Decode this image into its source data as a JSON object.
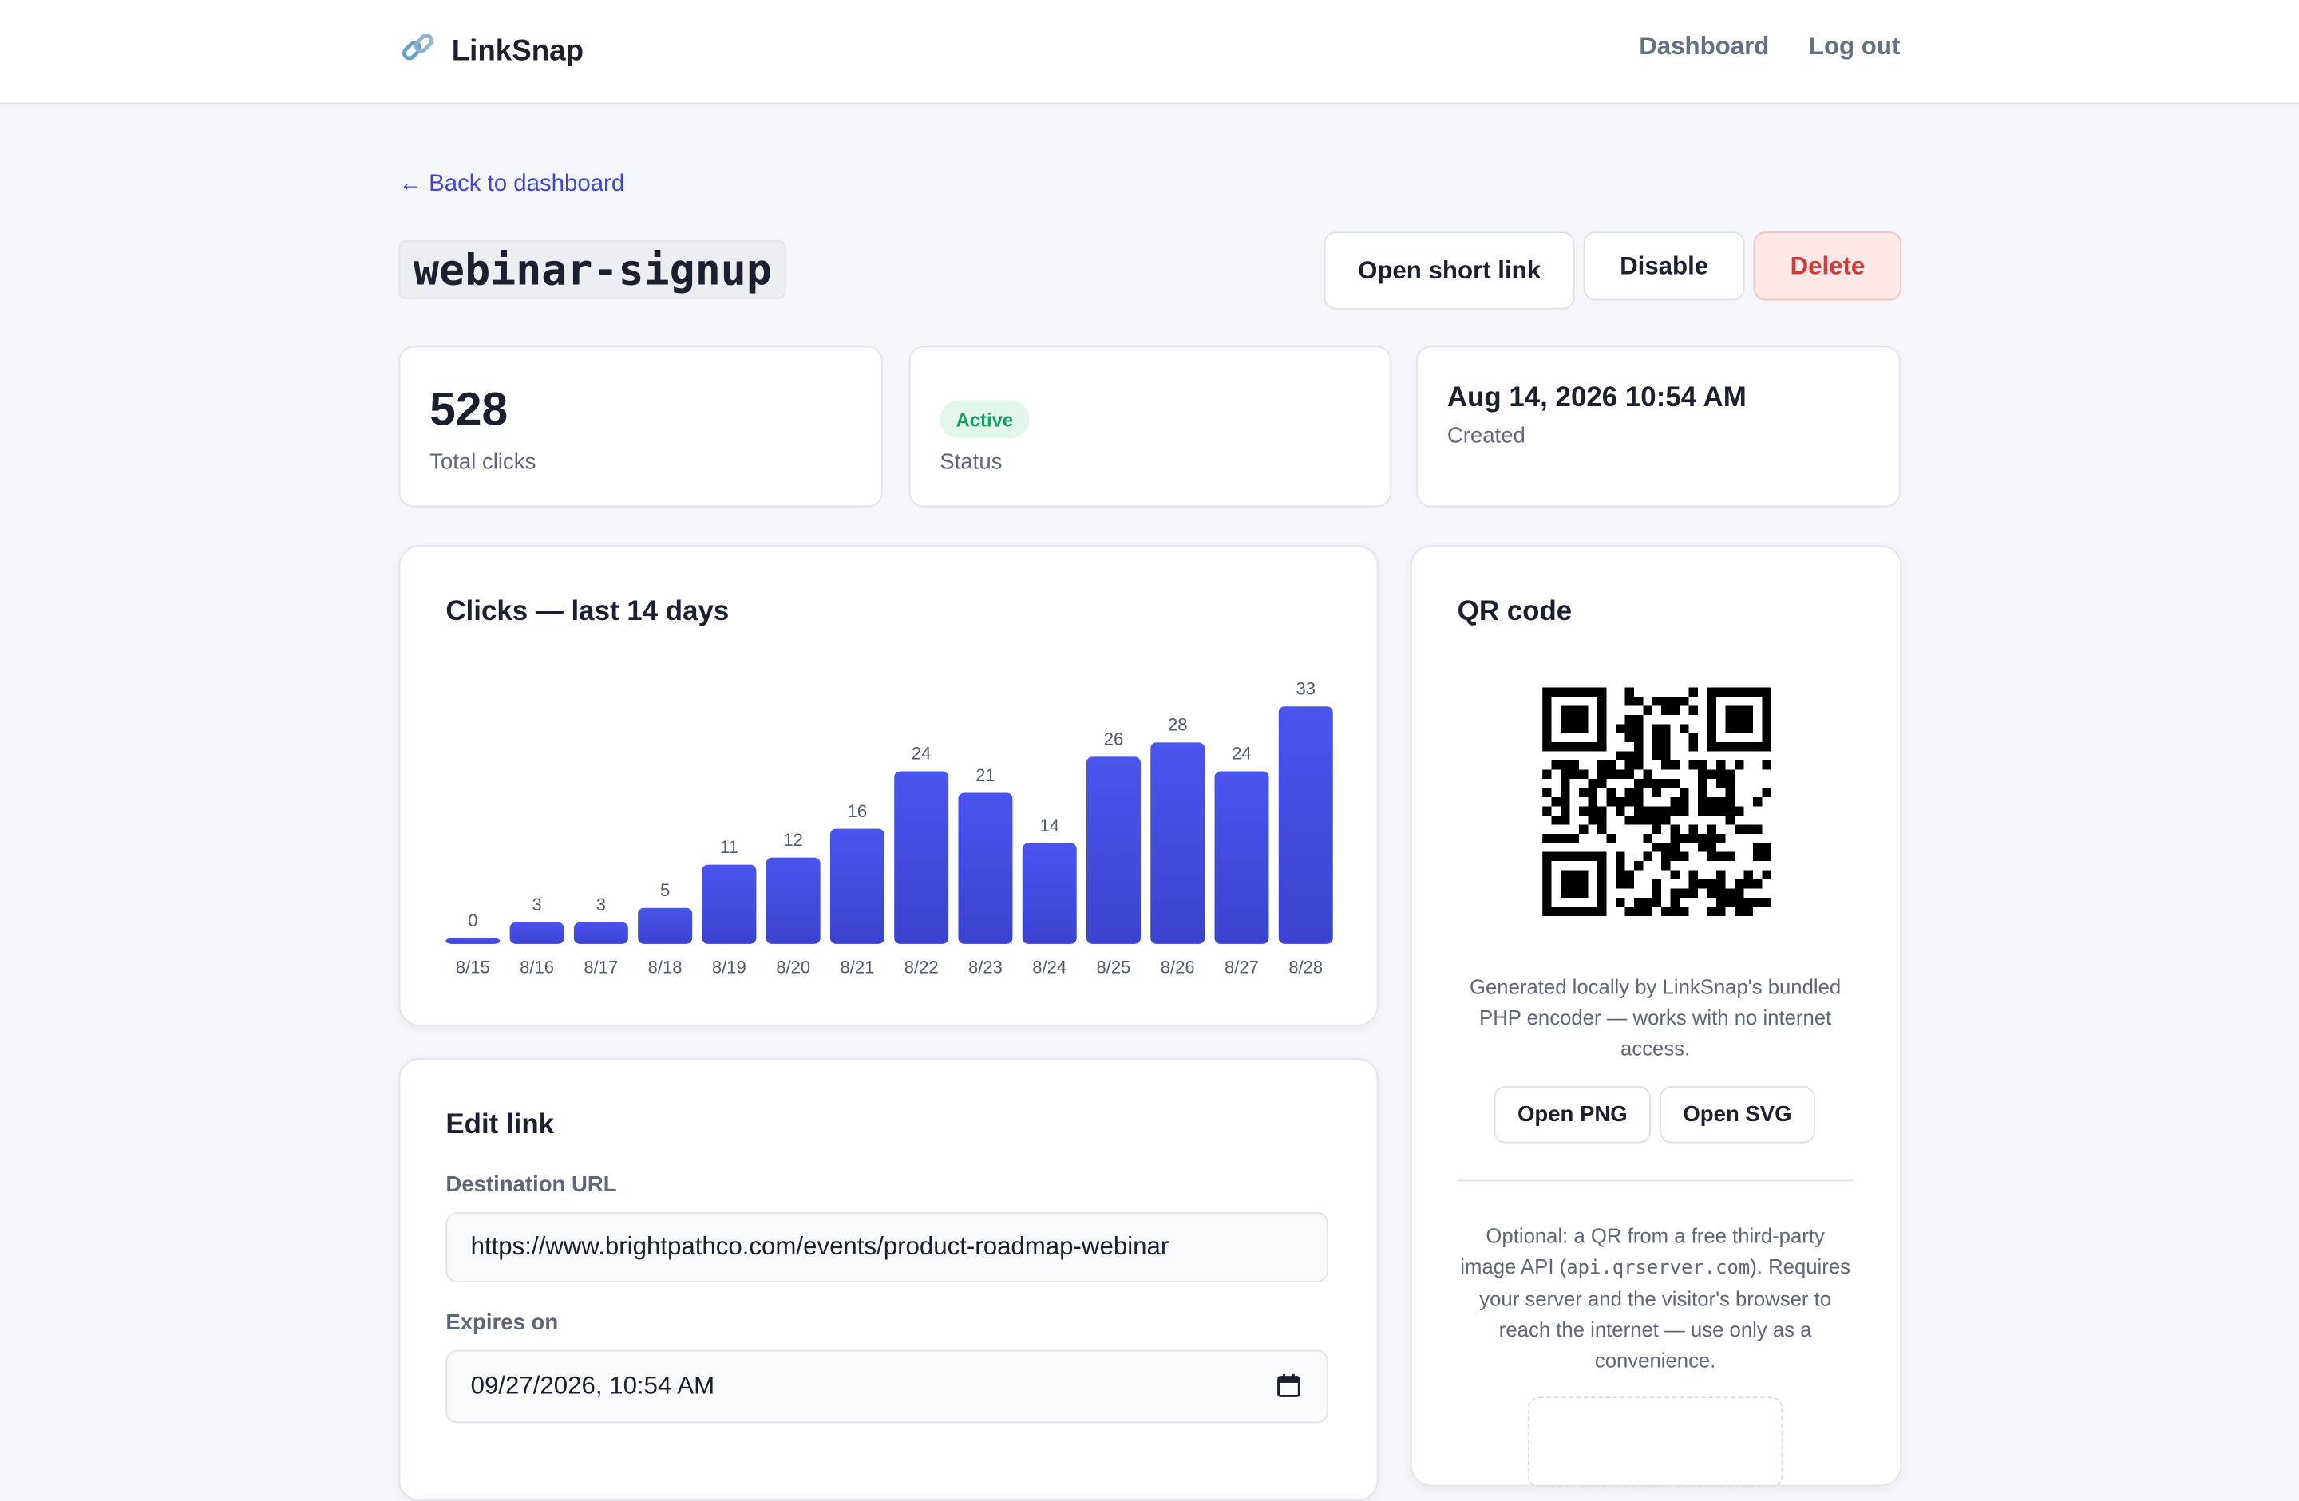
{
  "header": {
    "brand": "LinkSnap",
    "brand_icon": "link-icon",
    "nav": {
      "dashboard": "Dashboard",
      "logout": "Log out"
    }
  },
  "back_link": "← Back to dashboard",
  "slug": "webinar-signup",
  "actions": {
    "open": "Open short link",
    "disable": "Disable",
    "delete": "Delete"
  },
  "stats": {
    "clicks_value": "528",
    "clicks_label": "Total clicks",
    "status_value": "Active",
    "status_label": "Status",
    "created_value": "Aug 14, 2026 10:54 AM",
    "created_label": "Created"
  },
  "colors": {
    "accent": "#3d46d6",
    "bar_top": "#4a54ee",
    "bar_bottom": "#3a43cf",
    "active": "#17a05a",
    "danger": "#d43a3a"
  },
  "chart": {
    "title": "Clicks — last 14 days"
  },
  "chart_data": {
    "type": "bar",
    "title": "Clicks — last 14 days",
    "categories": [
      "8/15",
      "8/16",
      "8/17",
      "8/18",
      "8/19",
      "8/20",
      "8/21",
      "8/22",
      "8/23",
      "8/24",
      "8/25",
      "8/26",
      "8/27",
      "8/28"
    ],
    "values": [
      0,
      3,
      3,
      5,
      11,
      12,
      16,
      24,
      21,
      14,
      26,
      28,
      24,
      33
    ],
    "xlabel": "",
    "ylabel": "",
    "ylim": [
      0,
      33
    ],
    "grid": false,
    "data_labels": true
  },
  "qr": {
    "title": "QR code",
    "note": "Generated locally by LinkSnap's bundled PHP encoder — works with no internet access.",
    "open_png": "Open PNG",
    "open_svg": "Open SVG",
    "optional_pre": "Optional: a QR from a free third-party image API (",
    "optional_code": "api.qrserver.com",
    "optional_post": "). Requires your server and the visitor's browser to reach the internet — use only as a convenience."
  },
  "edit": {
    "title": "Edit link",
    "destination_label": "Destination URL",
    "destination_value": "https://www.brightpathco.com/events/product-roadmap-webinar",
    "expires_label": "Expires on",
    "expires_value": "09/27/2026, 10:54 AM"
  }
}
